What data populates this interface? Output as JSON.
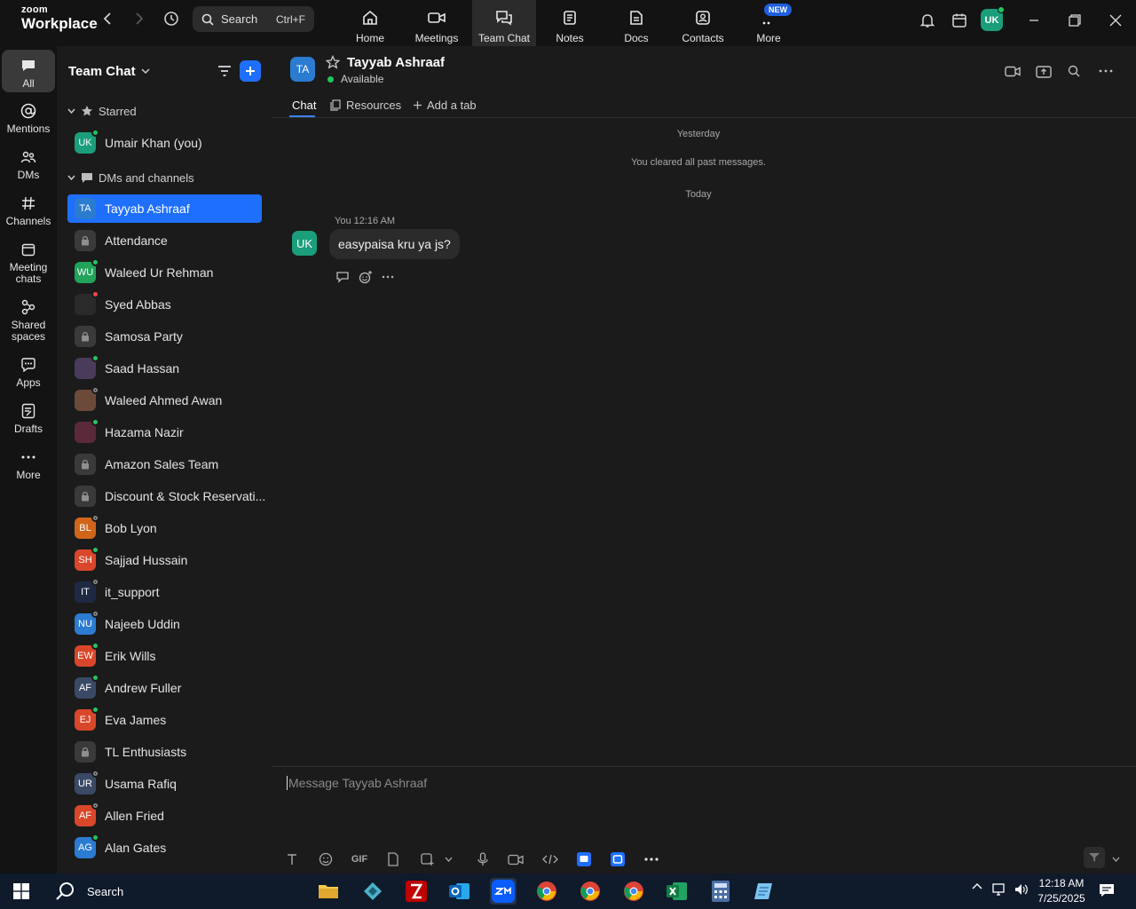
{
  "app": {
    "brand_top": "zoom",
    "brand_bottom": "Workplace"
  },
  "search": {
    "label": "Search",
    "shortcut": "Ctrl+F"
  },
  "top_tabs": [
    {
      "label": "Home",
      "icon": "home-icon"
    },
    {
      "label": "Meetings",
      "icon": "video-icon"
    },
    {
      "label": "Team Chat",
      "icon": "chat-icon",
      "active": true
    },
    {
      "label": "Notes",
      "icon": "notes-icon"
    },
    {
      "label": "Docs",
      "icon": "docs-icon"
    },
    {
      "label": "Contacts",
      "icon": "contacts-icon"
    },
    {
      "label": "More",
      "icon": "more-icon",
      "badge": "NEW"
    }
  ],
  "user_initials": "UK",
  "rail": [
    {
      "label": "All",
      "icon": "chat-bubble-icon",
      "active": true
    },
    {
      "label": "Mentions",
      "icon": "at-icon"
    },
    {
      "label": "DMs",
      "icon": "people-icon"
    },
    {
      "label": "Channels",
      "icon": "hash-icon"
    },
    {
      "label": "Meeting chats",
      "icon": "calendar-icon"
    },
    {
      "label": "Shared spaces",
      "icon": "shared-icon"
    },
    {
      "label": "Apps",
      "icon": "apps-icon"
    },
    {
      "label": "Drafts",
      "icon": "drafts-icon"
    },
    {
      "label": "More",
      "icon": "ellipsis-icon"
    }
  ],
  "sidebar": {
    "title": "Team Chat",
    "starred_label": "Starred",
    "dms_label": "DMs and channels",
    "starred": [
      {
        "name": "Umair Khan (you)",
        "initials": "UK",
        "color": "#1a9e7b",
        "status": "on"
      }
    ],
    "items": [
      {
        "name": "Tayyab Ashraaf",
        "initials": "TA",
        "color": "#2b7bd1",
        "status": "",
        "selected": true
      },
      {
        "name": "Attendance",
        "initials": "",
        "color": "#3a3a3a",
        "status": "",
        "lock": true
      },
      {
        "name": "Waleed Ur Rehman",
        "initials": "WU",
        "color": "#22a35a",
        "status": "on"
      },
      {
        "name": "Syed Abbas",
        "initials": "",
        "color": "#2a2a2a",
        "status": "busy"
      },
      {
        "name": "Samosa Party",
        "initials": "",
        "color": "#3a3a3a",
        "status": "",
        "lock": true
      },
      {
        "name": "Saad Hassan",
        "initials": "",
        "color": "#4a3b5a",
        "status": "on"
      },
      {
        "name": "Waleed Ahmed Awan",
        "initials": "",
        "color": "#6b4a3a",
        "status": "off"
      },
      {
        "name": "Hazama Nazir",
        "initials": "",
        "color": "#5a2a3a",
        "status": "on"
      },
      {
        "name": "Amazon Sales Team",
        "initials": "",
        "color": "#3a3a3a",
        "status": "",
        "lock": true
      },
      {
        "name": "Discount & Stock Reservati...",
        "initials": "",
        "color": "#3a3a3a",
        "status": "",
        "lock": true
      },
      {
        "name": "Bob Lyon",
        "initials": "BL",
        "color": "#d0651a",
        "status": "off"
      },
      {
        "name": "Sajjad Hussain",
        "initials": "SH",
        "color": "#d9472b",
        "status": "on"
      },
      {
        "name": "it_support",
        "initials": "IT",
        "color": "#1e2a44",
        "status": "off"
      },
      {
        "name": "Najeeb Uddin",
        "initials": "NU",
        "color": "#2b7bd1",
        "status": "off"
      },
      {
        "name": "Erik Wills",
        "initials": "EW",
        "color": "#d9472b",
        "status": "on"
      },
      {
        "name": "Andrew Fuller",
        "initials": "AF",
        "color": "#3a4a66",
        "status": "on"
      },
      {
        "name": "Eva James",
        "initials": "EJ",
        "color": "#d9472b",
        "status": "on"
      },
      {
        "name": "TL Enthusiasts",
        "initials": "",
        "color": "#3a3a3a",
        "status": "",
        "lock": true
      },
      {
        "name": "Usama Rafiq",
        "initials": "UR",
        "color": "#3a4a66",
        "status": "off"
      },
      {
        "name": "Allen Fried",
        "initials": "AF",
        "color": "#d9472b",
        "status": "off"
      },
      {
        "name": "Alan Gates",
        "initials": "AG",
        "color": "#2b7bd1",
        "status": "on"
      }
    ]
  },
  "chat": {
    "name": "Tayyab Ashraaf",
    "initials": "TA",
    "status": "Available",
    "tabs": {
      "chat": "Chat",
      "resources": "Resources",
      "add": "Add a tab"
    },
    "sys_yesterday": "Yesterday",
    "sys_cleared": "You cleared all past messages.",
    "sys_today": "Today",
    "message": {
      "sender_initials": "UK",
      "meta": "You 12:16 AM",
      "text": "easypaisa kru ya js?"
    },
    "composer_placeholder": "Message Tayyab Ashraaf",
    "gif_label": "GIF"
  },
  "taskbar": {
    "search_label": "Search",
    "time": "12:18 AM",
    "date": "7/25/2025"
  }
}
